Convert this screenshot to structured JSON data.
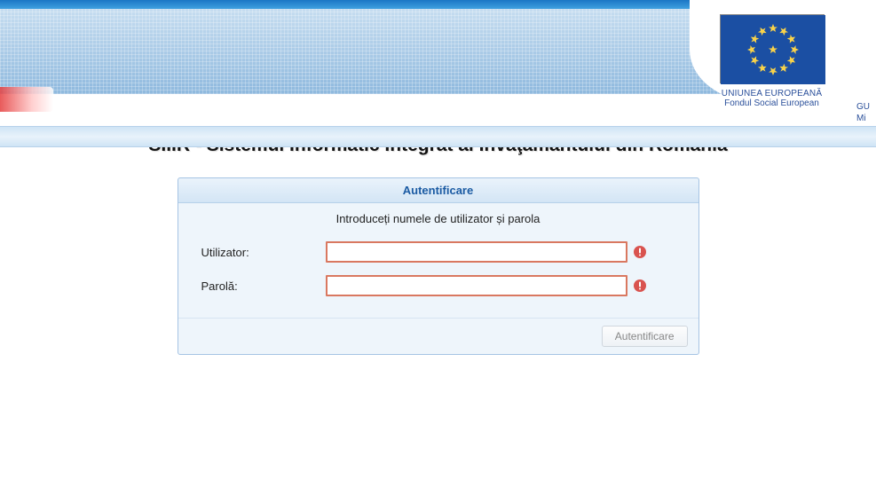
{
  "header": {
    "eu_line1": "UNIUNEA EUROPEANĂ",
    "eu_line2": "Fondul Social European",
    "partial_right_line1": "GU",
    "partial_right_line2": "Mi"
  },
  "page": {
    "title": "SIIIR - Sistemul Informatic Integrat al Învăţământului din România"
  },
  "login": {
    "panel_title": "Autentificare",
    "instruction": "Introduceți numele de utilizator și parola",
    "user_label": "Utilizator:",
    "pass_label": "Parolă:",
    "user_value": "",
    "pass_value": "",
    "submit_label": "Autentificare"
  }
}
